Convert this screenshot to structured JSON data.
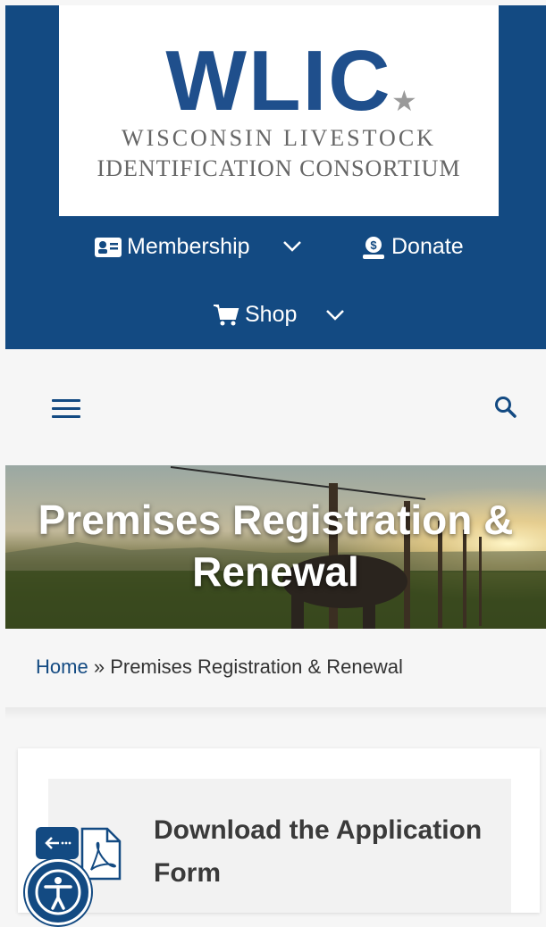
{
  "logo": {
    "wordmark": "WLIC",
    "line1": "WISCONSIN LIVESTOCK",
    "line2": "IDENTIFICATION CONSORTIUM"
  },
  "nav": {
    "membership": "Membership",
    "donate": "Donate",
    "shop": "Shop"
  },
  "hero": {
    "title": "Premises Registration & Renewal"
  },
  "breadcrumb": {
    "home": "Home",
    "separator": "»",
    "current": "Premises Registration & Renewal"
  },
  "card": {
    "title": "Download the Application Form"
  },
  "colors": {
    "brand_blue": "#134a82",
    "background": "#f6f6f6"
  },
  "icons": [
    "id-card-icon",
    "donate-icon",
    "cart-icon",
    "chevron-down-icon",
    "hamburger-icon",
    "search-icon",
    "pdf-icon",
    "back-arrow-icon",
    "accessibility-icon"
  ]
}
